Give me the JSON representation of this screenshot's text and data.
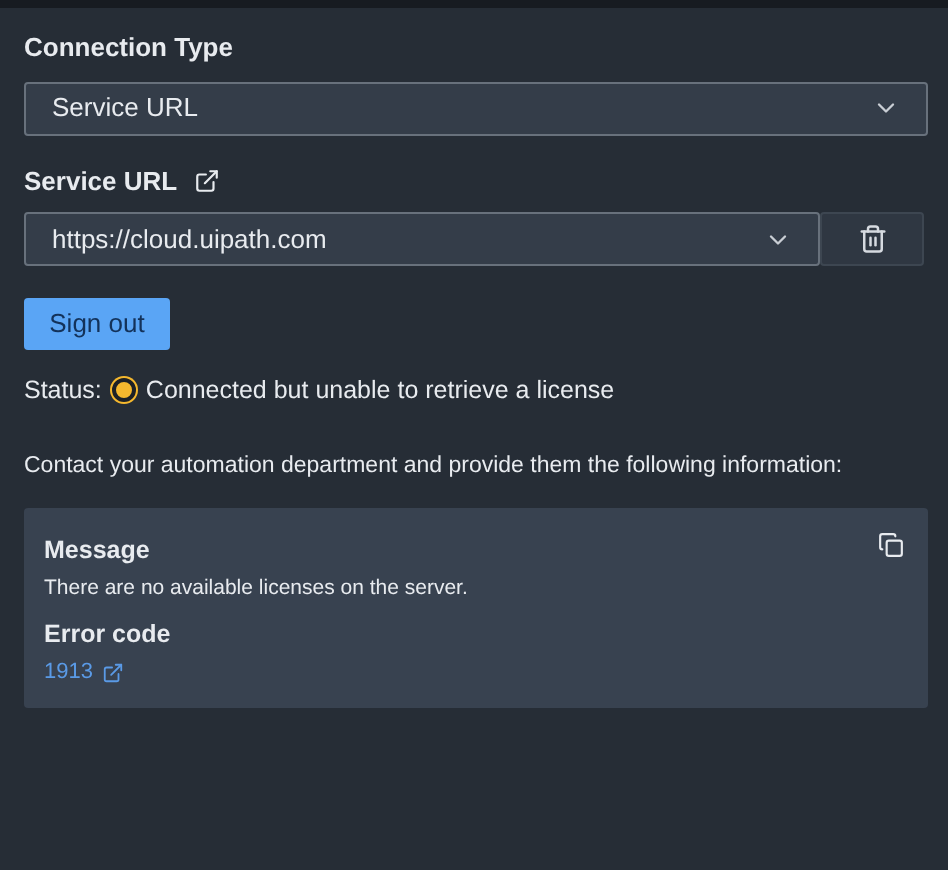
{
  "connection_type": {
    "label": "Connection Type",
    "value": "Service URL"
  },
  "service_url": {
    "label": "Service URL",
    "value": "https://cloud.uipath.com"
  },
  "sign_out_button": "Sign out",
  "status": {
    "label": "Status:",
    "kind": "warning",
    "text": "Connected but unable to retrieve a license"
  },
  "instructions": "Contact your automation department and provide them the following information:",
  "info_card": {
    "message_label": "Message",
    "message": "There are no available licenses on the server.",
    "error_code_label": "Error code",
    "error_code": "1913"
  }
}
